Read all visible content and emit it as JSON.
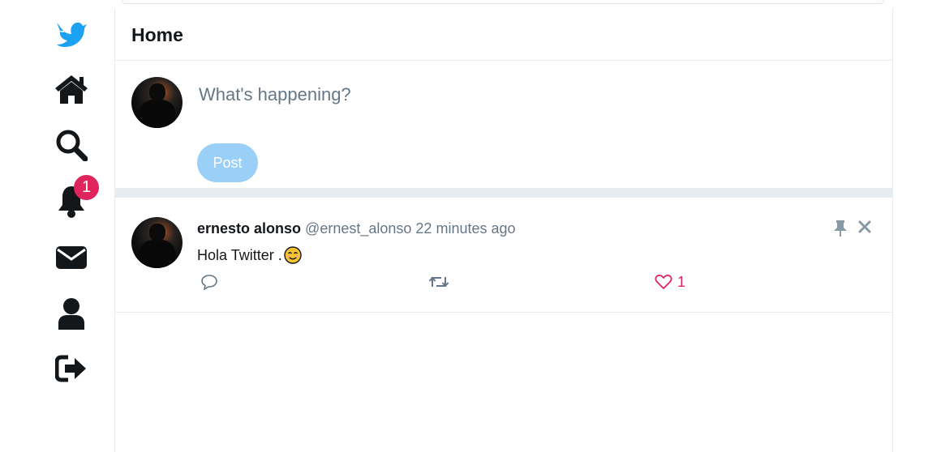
{
  "sidebar": {
    "items": [
      {
        "name": "bird-logo",
        "icon": "bird-icon"
      },
      {
        "name": "home",
        "icon": "home-icon"
      },
      {
        "name": "explore",
        "icon": "search-icon"
      },
      {
        "name": "notifications",
        "icon": "bell-icon",
        "badge": "1"
      },
      {
        "name": "messages",
        "icon": "envelope-icon"
      },
      {
        "name": "profile",
        "icon": "user-icon"
      },
      {
        "name": "logout",
        "icon": "sign-out-icon"
      }
    ],
    "notification_badge": "1",
    "colors": {
      "brand": "#1da1f2",
      "icon": "#14171a",
      "badge": "#e0245e"
    }
  },
  "header": {
    "title": "Home"
  },
  "composer": {
    "placeholder": "What's happening?",
    "post_label": "Post",
    "post_button_color": "#9ad0f7"
  },
  "tweets": [
    {
      "author_name": "ernesto alonso",
      "author_handle": "@ernest_alonso",
      "timestamp": "22 minutes ago",
      "text": "Hola Twitter .",
      "emoji": "smiling-face-icon",
      "like_count": "1",
      "like_color": "#e0245e"
    }
  ]
}
